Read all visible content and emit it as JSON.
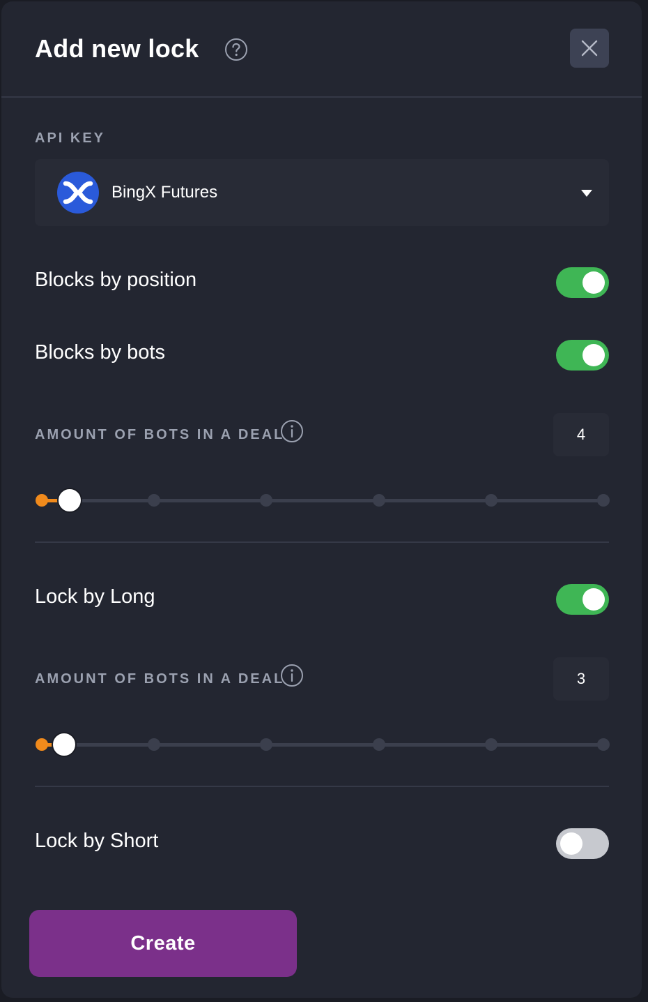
{
  "header": {
    "title": "Add new lock",
    "help_icon": "question-circle-icon",
    "close_icon": "close-icon"
  },
  "api_key": {
    "label": "API KEY",
    "selected": "BingX Futures",
    "logo_icon": "bingx-logo-icon",
    "caret_icon": "caret-down-icon"
  },
  "blocks_by_position": {
    "label": "Blocks by position",
    "enabled": true
  },
  "blocks_by_bots": {
    "label": "Blocks by bots",
    "enabled": true,
    "amount": {
      "label": "AMOUNT OF BOTS IN A DEAL",
      "info_icon": "info-icon",
      "value": "4",
      "slider_steps": 6,
      "slider_fraction": 0.05
    }
  },
  "lock_by_long": {
    "label": "Lock by Long",
    "enabled": true,
    "amount": {
      "label": "AMOUNT OF BOTS IN A DEAL",
      "info_icon": "info-icon",
      "value": "3",
      "slider_steps": 6,
      "slider_fraction": 0.04
    }
  },
  "lock_by_short": {
    "label": "Lock by Short",
    "enabled": false
  },
  "actions": {
    "create_label": "Create"
  },
  "colors": {
    "background": "#232631",
    "toggle_on": "#3fb655",
    "toggle_off": "#c7c9cf",
    "slider_accent": "#f08a1c",
    "create_button": "#7b308a",
    "bingx_blue": "#2a5ada"
  }
}
